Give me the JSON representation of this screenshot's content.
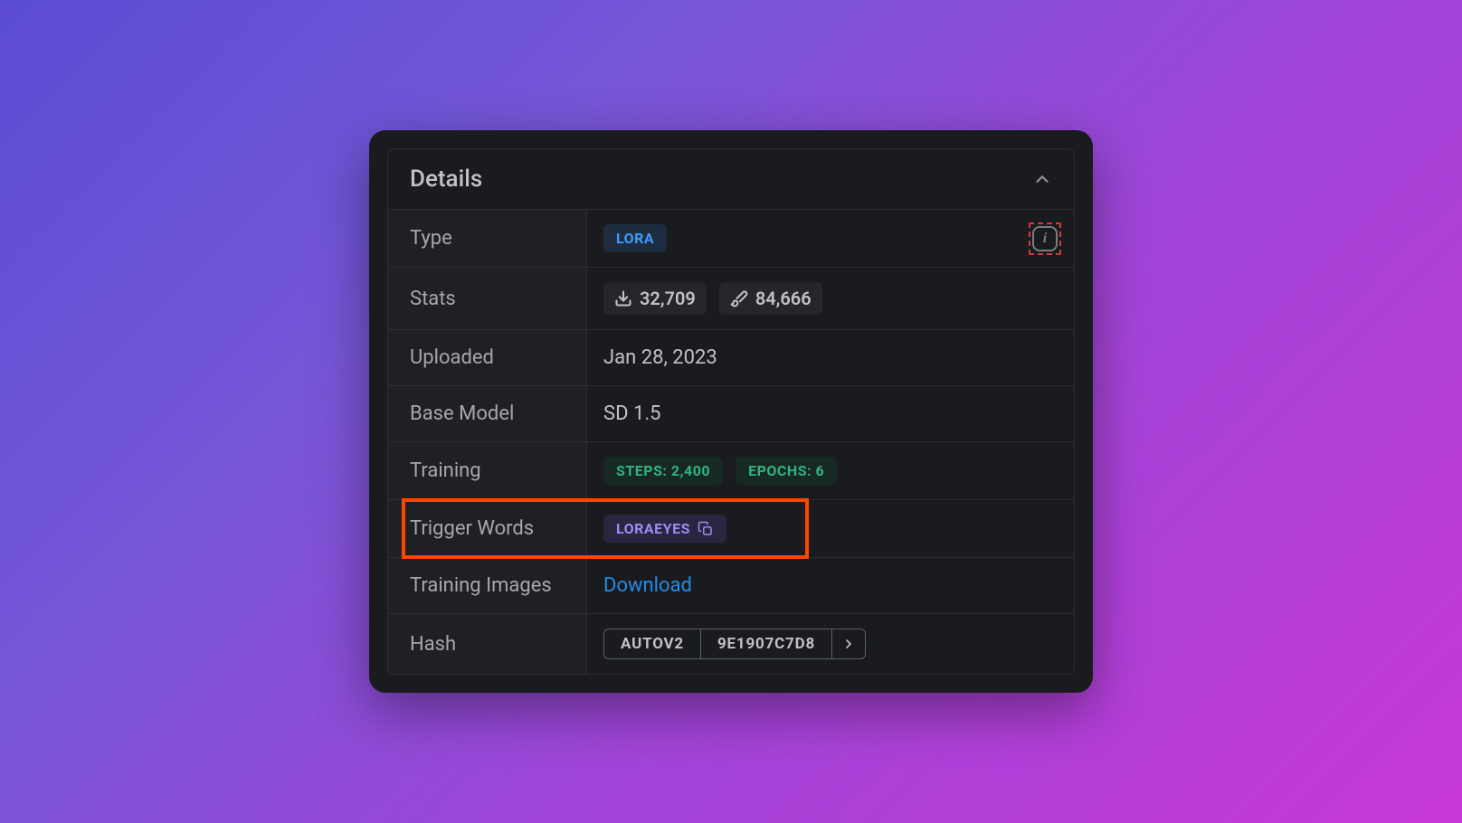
{
  "header": {
    "title": "Details"
  },
  "rows": {
    "type": {
      "label": "Type",
      "badge": "LORA"
    },
    "stats": {
      "label": "Stats",
      "downloads": "32,709",
      "generations": "84,666"
    },
    "uploaded": {
      "label": "Uploaded",
      "value": "Jan 28, 2023"
    },
    "base_model": {
      "label": "Base Model",
      "value": "SD 1.5"
    },
    "training": {
      "label": "Training",
      "steps": "STEPS: 2,400",
      "epochs": "EPOCHS: 6"
    },
    "trigger": {
      "label": "Trigger Words",
      "word": "LORAEYES"
    },
    "training_images": {
      "label": "Training Images",
      "link": "Download"
    },
    "hash": {
      "label": "Hash",
      "algo": "AUTOV2",
      "value": "9E1907C7D8"
    }
  },
  "info_glyph": "i"
}
